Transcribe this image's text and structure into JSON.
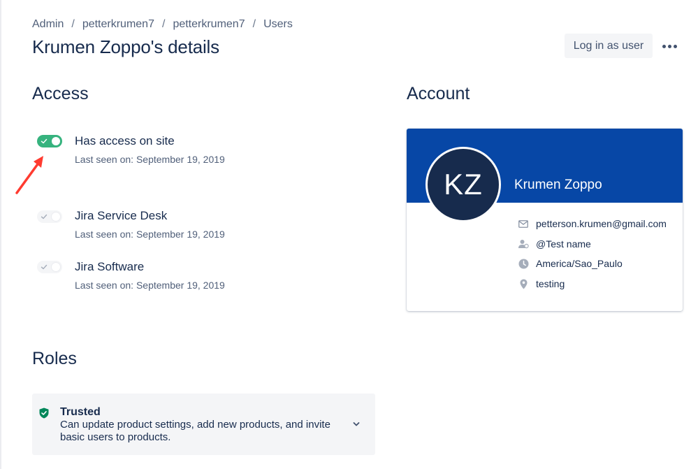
{
  "breadcrumb": [
    "Admin",
    "petterkrumen7",
    "petterkrumen7",
    "Users"
  ],
  "page": {
    "title": "Krumen Zoppo's details"
  },
  "actions": {
    "login_label": "Log in as user",
    "more_icon": "more-horizontal-icon"
  },
  "access": {
    "title": "Access",
    "items": [
      {
        "label": "Has access on site",
        "seen": "Last seen on: September 19, 2019",
        "enabled": true
      },
      {
        "label": "Jira Service Desk",
        "seen": "Last seen on: September 19, 2019",
        "enabled": false
      },
      {
        "label": "Jira Software",
        "seen": "Last seen on: September 19, 2019",
        "enabled": false
      }
    ]
  },
  "account": {
    "title": "Account",
    "initials": "KZ",
    "name": "Krumen Zoppo",
    "email": "petterson.krumen@gmail.com",
    "public_name": "@Test name",
    "timezone": "America/Sao_Paulo",
    "location": "testing"
  },
  "roles": {
    "title": "Roles",
    "items": [
      {
        "name": "Trusted",
        "description": "Can update product settings, add new products, and invite basic users to products."
      }
    ]
  },
  "colors": {
    "header_blue": "#0747A6",
    "toggle_green": "#36B37E",
    "avatar_bg": "#172B4D",
    "arrow_red": "#FF3B30"
  }
}
